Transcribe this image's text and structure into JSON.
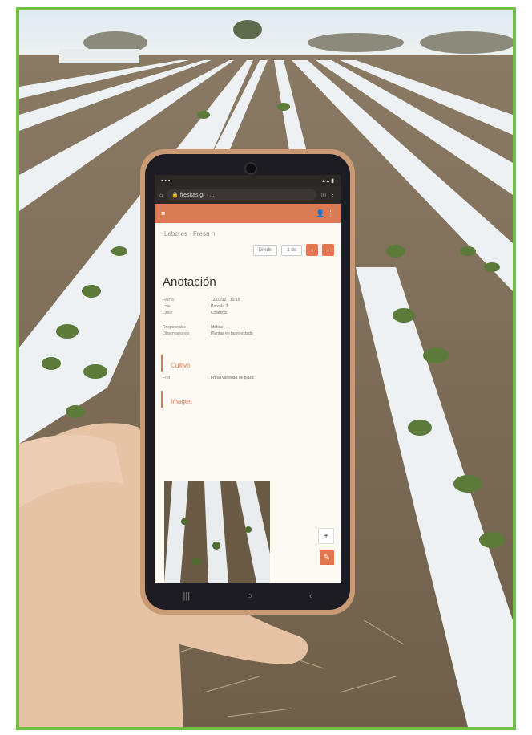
{
  "app_screen": {
    "browser_url": "fresitas.gr · ...",
    "breadcrumb": "Labores · Fresa n",
    "action_ghost_label": "Dividir",
    "action_ghost_label2": "1 de",
    "page_title": "Anotación",
    "fields_group_1": [
      {
        "label": "Fecha",
        "value": "13/01/22 · 10:15"
      },
      {
        "label": "Lote",
        "value": "Parcela 3"
      },
      {
        "label": "Labor",
        "value": "Cosecha"
      }
    ],
    "fields_group_2": [
      {
        "label": "Responsable",
        "value": "Matías"
      },
      {
        "label": "Observaciones",
        "value": "Plantas en buen estado"
      }
    ],
    "section_1": "Cultivo",
    "section_1_field": {
      "label": "Frut",
      "value": "Fresa variedad de plaza"
    },
    "section_2": "Imagen"
  },
  "colors": {
    "border": "#71bf44",
    "accent": "#d87b54",
    "phone_case": "#c99a73"
  },
  "icons": [
    "home-icon",
    "lock-icon",
    "tab-icon",
    "menu-icon",
    "user-icon",
    "plus-icon",
    "edit-icon",
    "recents-icon",
    "home-nav-icon",
    "back-icon"
  ]
}
